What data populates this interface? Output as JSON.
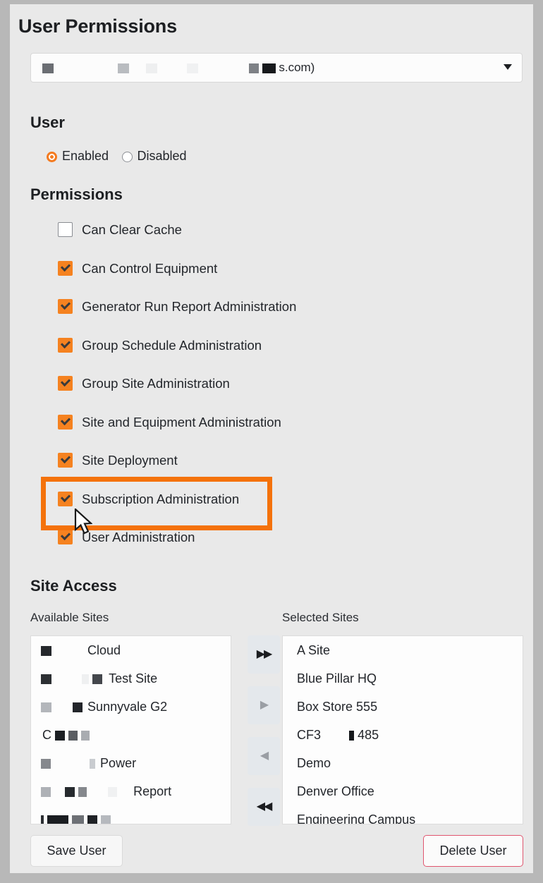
{
  "header": {
    "title": "User Permissions"
  },
  "user_select": {
    "value_visible_text": "s.com)",
    "redacted": true,
    "caret_icon": "chevron-down-icon"
  },
  "sections": {
    "user": "User",
    "permissions": "Permissions",
    "site_access": "Site Access"
  },
  "user_status": {
    "options": [
      {
        "label": "Enabled",
        "selected": true
      },
      {
        "label": "Disabled",
        "selected": false
      }
    ]
  },
  "permissions": [
    {
      "label": "Can Clear Cache",
      "checked": false
    },
    {
      "label": "Can Control Equipment",
      "checked": true
    },
    {
      "label": "Generator Run Report Administration",
      "checked": true
    },
    {
      "label": "Group Schedule Administration",
      "checked": true
    },
    {
      "label": "Group Site Administration",
      "checked": true
    },
    {
      "label": "Site and Equipment Administration",
      "checked": true
    },
    {
      "label": "Site Deployment",
      "checked": true
    },
    {
      "label": "Subscription Administration",
      "checked": true,
      "highlighted": true
    },
    {
      "label": "User Administration",
      "checked": true
    }
  ],
  "site_access": {
    "available_label": "Available Sites",
    "selected_label": "Selected Sites",
    "available_sites": [
      {
        "text": "Cloud",
        "redacted": true
      },
      {
        "text": "Test Site",
        "redacted": true
      },
      {
        "text": "Sunnyvale G2",
        "redacted": true
      },
      {
        "text": "C",
        "redacted": true
      },
      {
        "text": "Power",
        "redacted": true
      },
      {
        "text": "Report",
        "redacted": true
      },
      {
        "text": "",
        "redacted": true
      }
    ],
    "selected_sites": [
      "A Site",
      "Blue Pillar HQ",
      "Box Store 555",
      "CF3        485",
      "Demo",
      "Denver Office",
      "Engineering Campus"
    ],
    "transfer_buttons": [
      {
        "icon": "double-chevron-right-icon",
        "glyph": "▶▶",
        "state": "enabled"
      },
      {
        "icon": "chevron-right-icon",
        "glyph": "▶",
        "state": "disabled"
      },
      {
        "icon": "chevron-left-icon",
        "glyph": "◀",
        "state": "disabled"
      },
      {
        "icon": "double-chevron-left-icon",
        "glyph": "◀◀",
        "state": "enabled"
      }
    ]
  },
  "footer": {
    "save_label": "Save User",
    "delete_label": "Delete User"
  },
  "colors": {
    "accent_orange": "#f58220",
    "annotation_orange": "#f4720b",
    "delete_border_red": "#e0566f",
    "page_bg": "#e9e9e9",
    "outer_bg": "#b8b8b8"
  }
}
